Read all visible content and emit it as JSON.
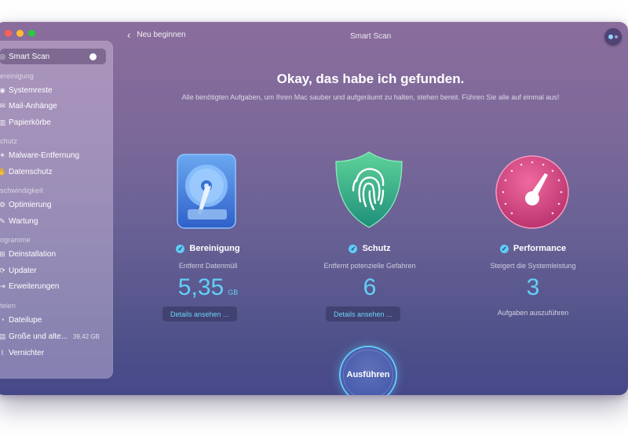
{
  "window": {
    "title": "Smart Scan",
    "back_label": "Neu beginnen",
    "colors": {
      "accent": "#62d0f7",
      "bg_top": "#8a6d9c",
      "bg_bottom": "#46488a"
    }
  },
  "sidebar": {
    "smart_scan": "Smart Scan",
    "sections": [
      {
        "label": "ereinigung",
        "items": [
          "Systemreste",
          "Mail-Anhänge",
          "Papierkörbe"
        ]
      },
      {
        "label": "chutz",
        "items": [
          "Malware-Entfernung",
          "Datenschutz"
        ]
      },
      {
        "label": "schwindigkeit",
        "items": [
          "Optimierung",
          "Wartung"
        ]
      },
      {
        "label": "ogramme",
        "items": [
          "Deinstallation",
          "Updater",
          "Erweiterungen"
        ]
      },
      {
        "label": "teien",
        "items": [
          "Dateilupe",
          "Große und alte...",
          "Vernichter"
        ]
      }
    ],
    "large_old_size": "39,42 GB"
  },
  "main": {
    "heading": "Okay, das habe ich gefunden.",
    "subheading": "Alle benötigten Aufgaben, um Ihren Mac sauber und aufgeräumt zu halten, stehen bereit. Führen Sie alle auf einmal aus!",
    "cards": [
      {
        "title": "Bereinigung",
        "subtitle": "Entfernt Datenmüll",
        "value": "5,35",
        "unit": "GB",
        "button": "Details ansehen ...",
        "icon": "hard-drive-icon"
      },
      {
        "title": "Schutz",
        "subtitle": "Entfernt potenzielle Gefahren",
        "value": "6",
        "button": "Details ansehen ...",
        "icon": "shield-fingerprint-icon"
      },
      {
        "title": "Performance",
        "subtitle": "Steigert die Systemleistung",
        "value": "3",
        "note": "Aufgaben auszuführen",
        "icon": "speedometer-icon"
      }
    ],
    "run_button": "Ausführen"
  }
}
